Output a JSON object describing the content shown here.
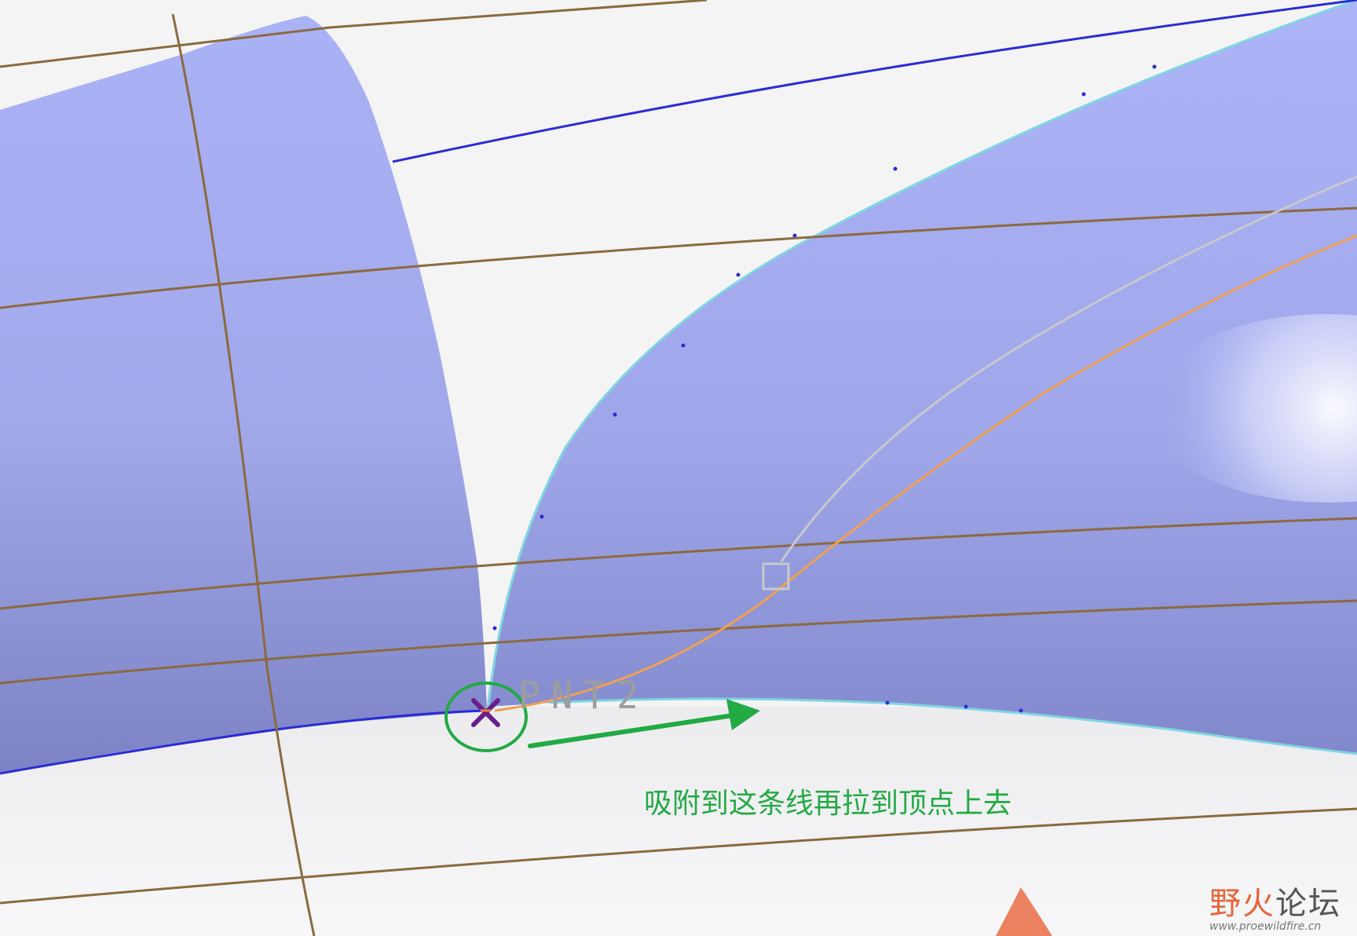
{
  "viewport": {
    "point_label": "PNT2",
    "annotation_text": "吸附到这条线再拉到顶点上去"
  },
  "watermark": {
    "chars": [
      "野",
      "火",
      "论",
      "坛"
    ],
    "url": "www.proewildfire.cn"
  },
  "colors": {
    "background": "#f4f4f5",
    "surface": "#aab0f4",
    "surface_shadow": "#7f86c9",
    "grid_line": "#8b6a3e",
    "edge_line": "#2b2bd6",
    "edge_highlight": "#7fd6e0",
    "curve_orange": "#f0a050",
    "curve_gray": "#c8c8cc",
    "annotation_green": "#22aa44",
    "point_marker": "#6a1f8c"
  }
}
